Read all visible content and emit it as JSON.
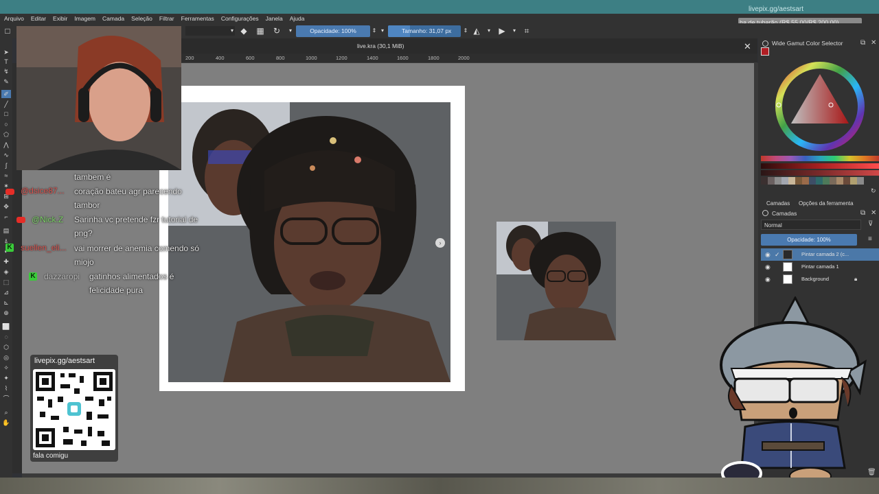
{
  "stream": {
    "top_url": "livepix.gg/aestsart",
    "goal_text": "ha de tubarão (R$ 55,00/R$ 200,00)"
  },
  "menu": [
    "Arquivo",
    "Editar",
    "Exibir",
    "Imagem",
    "Camada",
    "Seleção",
    "Filtrar",
    "Ferramentas",
    "Configurações",
    "Janela",
    "Ajuda"
  ],
  "toolbar": {
    "opacity_label": "Opacidade: 100%",
    "size_label": "Tamanho: 31,07 px",
    "size_fraction": 0.3
  },
  "document": {
    "title": "live.kra (30,1 MiB)",
    "ruler_labels": [
      "200",
      "400",
      "600",
      "800",
      "1000",
      "1200",
      "1400",
      "1600",
      "1800",
      "2000"
    ]
  },
  "chat": [
    {
      "user": "",
      "user_color": "#e8e8e8",
      "message": "tambem é",
      "badge": ""
    },
    {
      "user": "@dsice87...",
      "user_color": "#d9534f",
      "message": "coração bateu agr parecendo tambor",
      "badge": "yt"
    },
    {
      "user": "@Nick.Z",
      "user_color": "#7fd46a",
      "message": "Sarinha vc pretende fzr tutorial de png?",
      "badge": "yt"
    },
    {
      "user": "suellen_eli...",
      "user_color": "#d9534f",
      "message": "vai morrer de anemia comendo só miojo",
      "badge": "k"
    },
    {
      "user": "dazzaropi",
      "user_color": "#b9b9b9",
      "message": "gatinhos alimentados é felicidade pura",
      "badge": "k"
    }
  ],
  "qr": {
    "url": "livepix.gg/aestsart",
    "caption": "fala comigu"
  },
  "dockers": {
    "color_selector_title": "Wide Gamut Color Selector",
    "tab_layers": "Camadas",
    "tab_tool_options": "Opções da ferramenta",
    "layers_title": "Camadas",
    "blend_mode": "Normal",
    "layer_opacity": "Opacidade: 100%",
    "layers": [
      {
        "name": "Pintar camada 2 (c...",
        "active": true
      },
      {
        "name": "Pintar camada 1",
        "active": false
      },
      {
        "name": "Background",
        "active": false
      }
    ],
    "swatches": [
      "#3b3030",
      "#6a6060",
      "#8d8d8d",
      "#a3a7b0",
      "#c9b79a",
      "#7a5a3a",
      "#9b6b4a",
      "#3d4e66",
      "#2e6a6a",
      "#4d7a5a",
      "#7a6a5a",
      "#a88a6a",
      "#6a4a3a",
      "#b0a070",
      "#8a8a8a"
    ]
  }
}
